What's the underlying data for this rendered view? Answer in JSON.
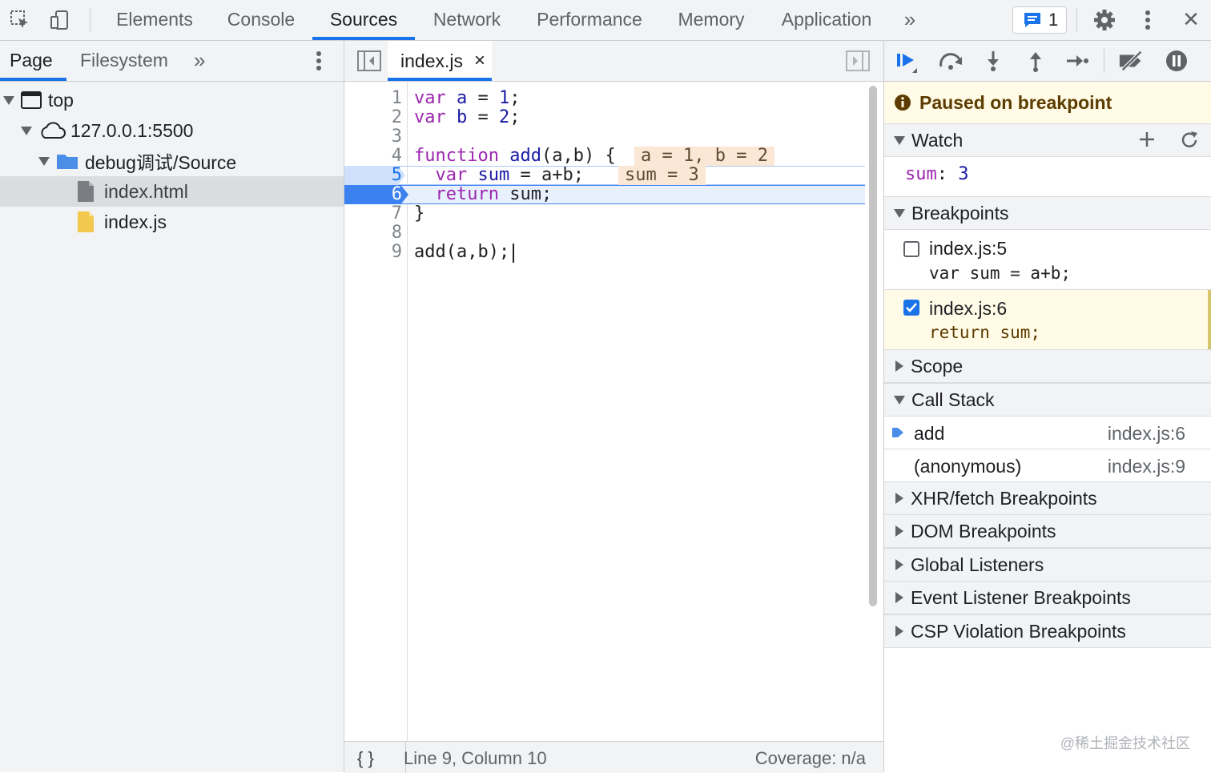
{
  "topbar": {
    "tabs": [
      "Elements",
      "Console",
      "Sources",
      "Network",
      "Performance",
      "Memory",
      "Application"
    ],
    "active_tab": "Sources",
    "more": "»",
    "message_count": "1",
    "close": "✕"
  },
  "navigator": {
    "tabs": [
      "Page",
      "Filesystem"
    ],
    "more": "»",
    "tree": {
      "top": "top",
      "host": "127.0.0.1:5500",
      "folder": "debug调试/Source",
      "files": [
        "index.html",
        "index.js"
      ]
    }
  },
  "editor": {
    "file_tab": "index.js",
    "file_tab_close": "×",
    "lines": [
      {
        "n": "1",
        "text": "var a = 1;"
      },
      {
        "n": "2",
        "text": "var b = 2;"
      },
      {
        "n": "3",
        "text": ""
      },
      {
        "n": "4",
        "text": "function add(a,b) {"
      },
      {
        "n": "5",
        "text": "  var sum = a+b;"
      },
      {
        "n": "6",
        "text": "  return sum;"
      },
      {
        "n": "7",
        "text": "}"
      },
      {
        "n": "8",
        "text": ""
      },
      {
        "n": "9",
        "text": "add(a,b);"
      }
    ],
    "inline_values": {
      "line4": "a = 1, b = 2",
      "line5": "sum = 3"
    },
    "status": {
      "format": "{ }",
      "cursor": "Line 9, Column 10",
      "coverage": "Coverage: n/a"
    }
  },
  "debugger": {
    "paused_message": "Paused on breakpoint",
    "watch": {
      "title": "Watch",
      "expr": "sum",
      "value": "3"
    },
    "breakpoints": {
      "title": "Breakpoints",
      "items": [
        {
          "location": "index.js:5",
          "code": "var sum = a+b;",
          "checked": false
        },
        {
          "location": "index.js:6",
          "code": "return sum;",
          "checked": true
        }
      ]
    },
    "scope_title": "Scope",
    "call_stack": {
      "title": "Call Stack",
      "frames": [
        {
          "name": "add",
          "location": "index.js:6"
        },
        {
          "name": "(anonymous)",
          "location": "index.js:9"
        }
      ]
    },
    "sections": [
      "XHR/fetch Breakpoints",
      "DOM Breakpoints",
      "Global Listeners",
      "Event Listener Breakpoints",
      "CSP Violation Breakpoints"
    ]
  },
  "watermark": "@稀土掘金技术社区",
  "colors": {
    "accent": "#1a73e8",
    "paused_bg": "#fffbe6",
    "keyword": "#9c27b0"
  }
}
